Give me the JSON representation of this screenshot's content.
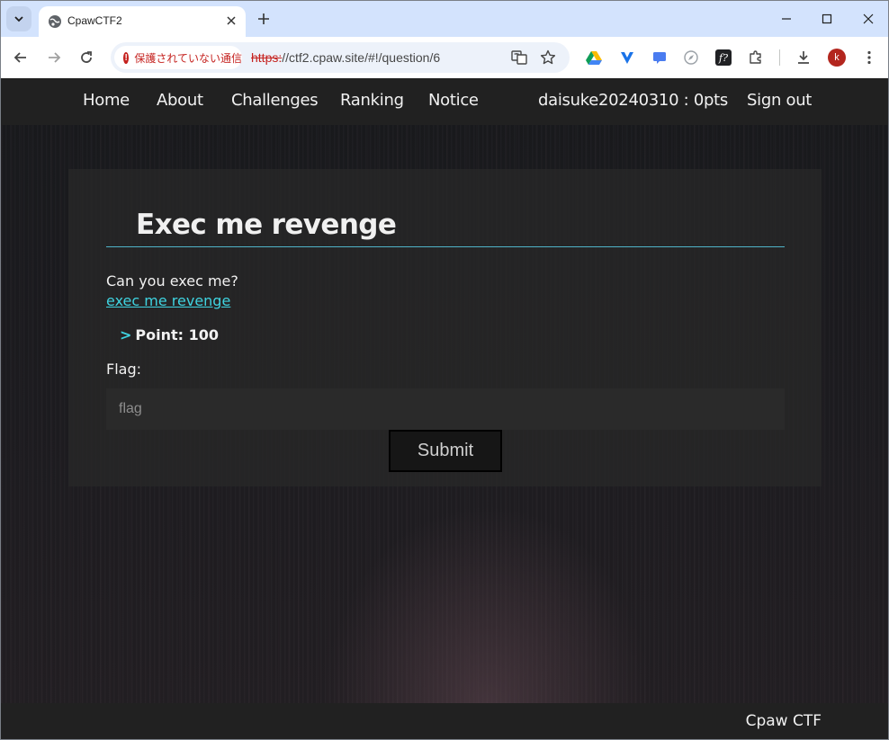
{
  "browser": {
    "tab_title": "CpawCTF2",
    "security_label": "保護されていない通信",
    "url_scheme": "https:",
    "url_rest": "//ctf2.cpaw.site/#!/question/6",
    "avatar_letter": "k"
  },
  "nav": {
    "home": "Home",
    "about": "About",
    "challenges": "Challenges",
    "ranking": "Ranking",
    "notice": "Notice",
    "user": "daisuke20240310 : 0pts",
    "signout": "Sign out"
  },
  "question": {
    "title": "Exec me revenge",
    "description": "Can you exec me?",
    "link": "exec me revenge",
    "point_caret": ">",
    "point": "Point: 100",
    "flag_label": "Flag:",
    "flag_placeholder": "flag",
    "submit": "Submit"
  },
  "footer": {
    "text": "Cpaw CTF"
  },
  "colors": {
    "accent": "#3fd3e0",
    "nav_bg": "#212121",
    "panel_bg": "#282828",
    "insecure": "#c5221f"
  },
  "icons": [
    "tab-search-icon",
    "globe-icon",
    "close-icon",
    "plus-icon",
    "minimize-icon",
    "maximize-icon",
    "back-icon",
    "forward-icon",
    "reload-icon",
    "translate-icon",
    "star-icon",
    "drive-icon",
    "extension-icon",
    "puzzle-icon",
    "download-icon",
    "menu-icon"
  ]
}
